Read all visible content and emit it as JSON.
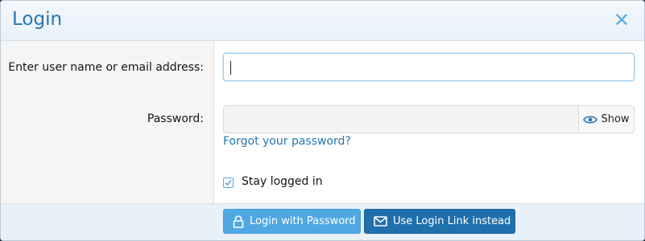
{
  "dialog": {
    "title": "Login",
    "close_icon": "close-icon"
  },
  "form": {
    "username": {
      "label": "Enter user name or email address:",
      "value": "",
      "placeholder": ""
    },
    "password": {
      "label": "Password:",
      "value": "",
      "placeholder": "",
      "show_label": "Show",
      "show_icon": "eye-icon"
    },
    "forgot_link": "Forgot your password?",
    "stay_logged_in": {
      "label": "Stay logged in",
      "checked": true
    }
  },
  "footer": {
    "login_password_label": "Login with Password",
    "login_password_icon": "lock-icon",
    "login_link_label": "Use Login Link instead",
    "login_link_icon": "envelope-icon"
  },
  "colors": {
    "title": "#2577b1",
    "primary_button": "#4fa8e2",
    "secondary_button": "#1f70ad",
    "link": "#2577b1"
  }
}
